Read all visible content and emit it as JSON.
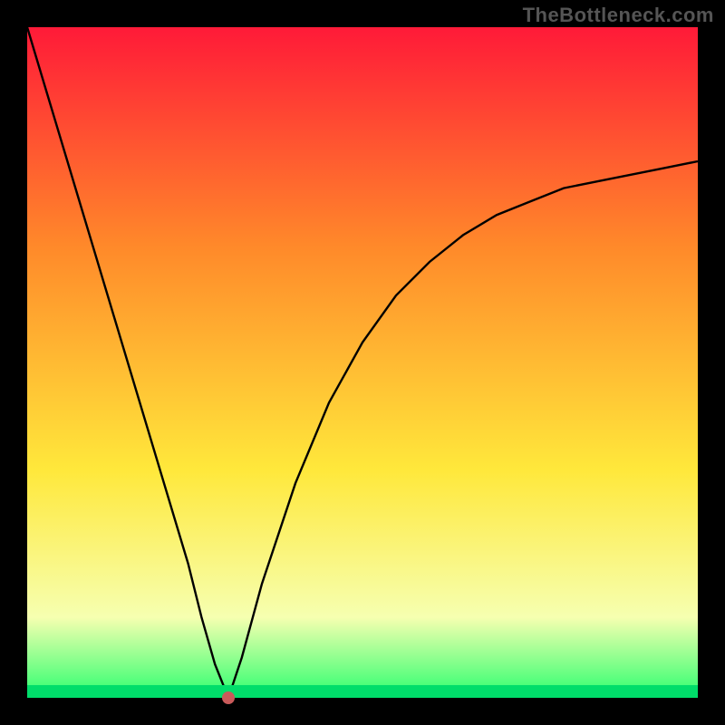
{
  "watermark": "TheBottleneck.com",
  "chart_data": {
    "type": "line",
    "title": "",
    "xlabel": "",
    "ylabel": "",
    "xlim": [
      0,
      100
    ],
    "ylim": [
      0,
      100
    ],
    "background_gradient_stops": [
      {
        "offset": 0,
        "color": "#ff1a38"
      },
      {
        "offset": 33,
        "color": "#ff8a2a"
      },
      {
        "offset": 66,
        "color": "#ffe83b"
      },
      {
        "offset": 88,
        "color": "#f6ffb0"
      },
      {
        "offset": 98,
        "color": "#4dff7a"
      },
      {
        "offset": 100,
        "color": "#00e56a"
      }
    ],
    "marker": {
      "x": 30,
      "y": 0,
      "color": "#c95a5a"
    },
    "series": [
      {
        "name": "curve",
        "x": [
          0,
          3,
          6,
          9,
          12,
          15,
          18,
          21,
          24,
          26,
          28,
          30,
          32,
          35,
          40,
          45,
          50,
          55,
          60,
          65,
          70,
          75,
          80,
          85,
          90,
          95,
          100
        ],
        "values": [
          100,
          90,
          80,
          70,
          60,
          50,
          40,
          30,
          20,
          12,
          5,
          0,
          6,
          17,
          32,
          44,
          53,
          60,
          65,
          69,
          72,
          74,
          76,
          77,
          78,
          79,
          80
        ]
      }
    ]
  }
}
